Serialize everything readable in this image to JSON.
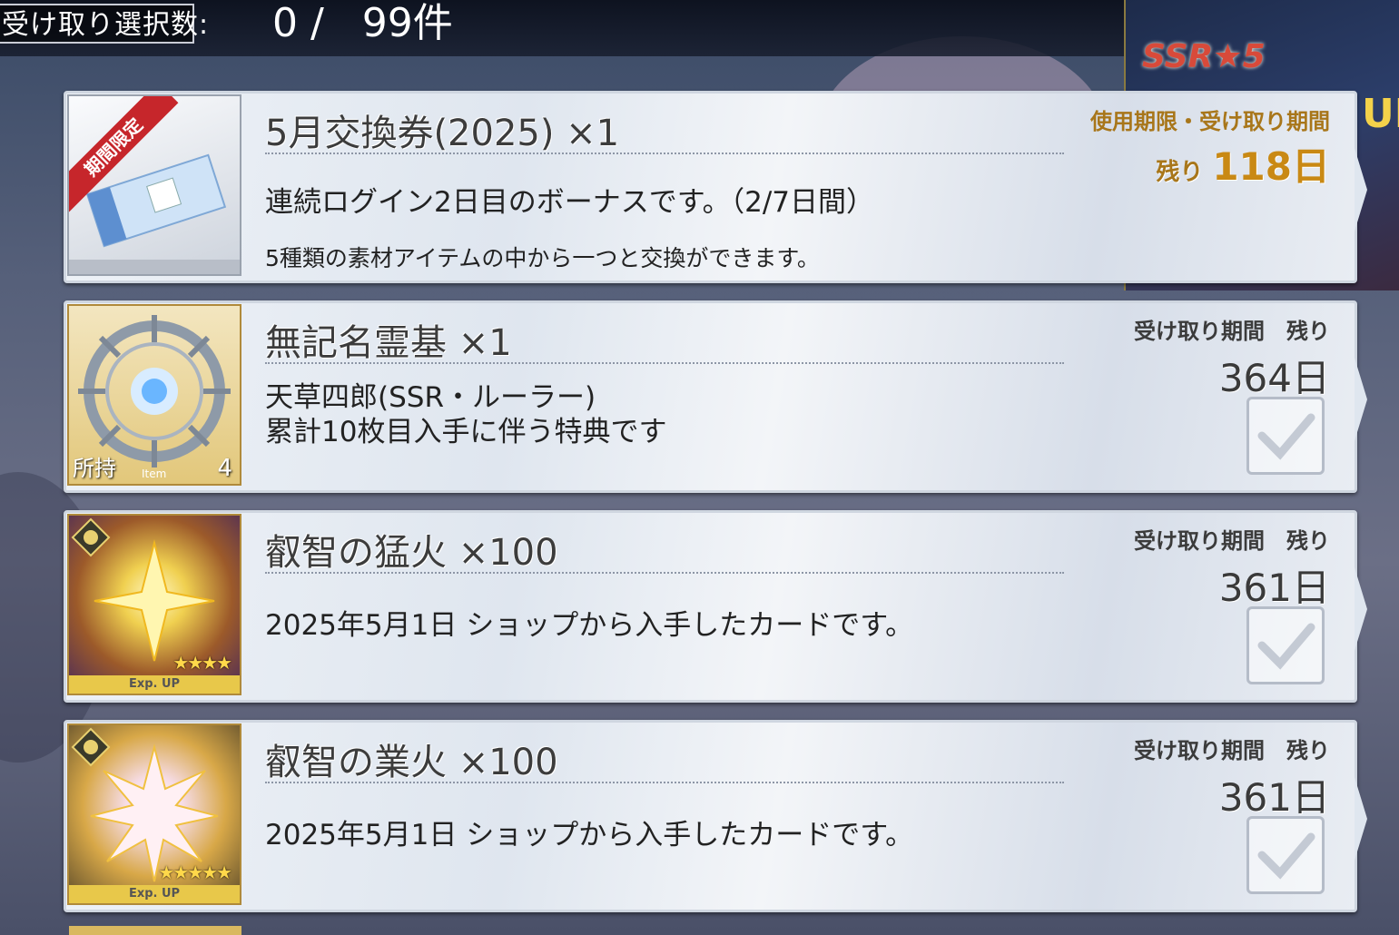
{
  "header": {
    "count_label": "受け取り選択数:",
    "count_value": "0 /   99件"
  },
  "banner": {
    "text": "SSR★5",
    "suffix": "UP"
  },
  "items": [
    {
      "title": "5月交換券(2025) ×1",
      "ribbon": "期間限定",
      "description": "連続ログイン2日目のボーナスです。（2/7日間）",
      "description2": "5種類の素材アイテムの中から一つと交換ができます。",
      "period_label": "使用期限・受け取り期間",
      "remain_prefix": "残り",
      "days": "118日"
    },
    {
      "title": "無記名霊基 ×1",
      "description": "天草四郎(SSR・ルーラー)\n累計10枚目入手に伴う特典です",
      "period_label": "受け取り期間　残り",
      "days": "364日",
      "owned_label": "所持",
      "owned_sub": "Item",
      "owned_count": "4"
    },
    {
      "title": "叡智の猛火 ×100",
      "description": "2025年5月1日 ショップから入手したカードです。",
      "period_label": "受け取り期間　残り",
      "days": "361日",
      "stars": "★★★★",
      "exp_label": "Exp. UP"
    },
    {
      "title": "叡智の業火 ×100",
      "description": "2025年5月1日 ショップから入手したカードです。",
      "period_label": "受け取り期間　残り",
      "days": "361日",
      "stars": "★★★★★",
      "exp_label": "Exp. UP"
    }
  ],
  "colors": {
    "gold_text": "#c98914",
    "ribbon_red": "#c6262b",
    "card_bg": "#e6ebf2"
  }
}
